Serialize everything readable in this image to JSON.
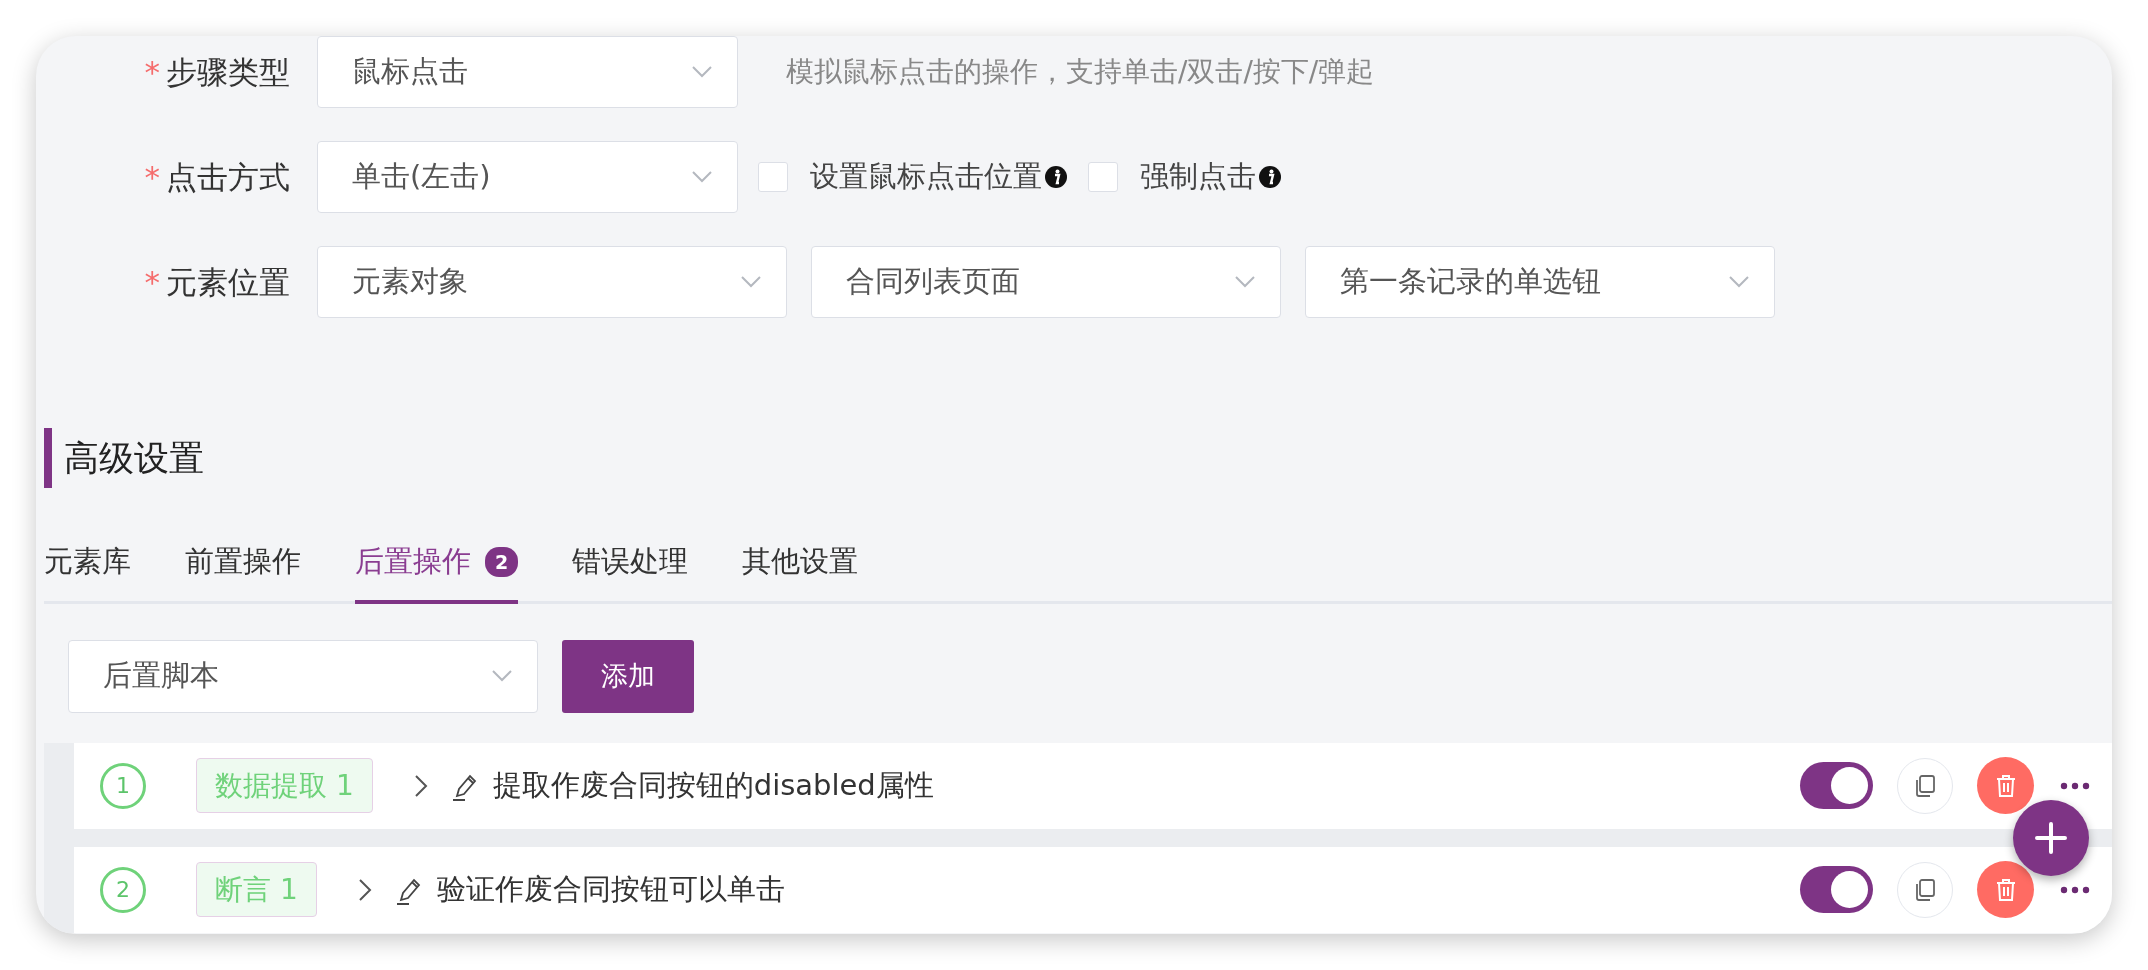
{
  "form": [
    {
      "label": "步骤类型",
      "required_mark": "*",
      "controls": [
        {
          "kind": "select",
          "value": "鼠标点击"
        },
        {
          "kind": "hint",
          "text": "模拟鼠标点击的操作，支持单击/双击/按下/弹起"
        }
      ]
    },
    {
      "label": "点击方式",
      "required_mark": "*",
      "controls": [
        {
          "kind": "select",
          "value": "单击(左击)"
        },
        {
          "kind": "checkbox",
          "label": "设置鼠标点击位置",
          "checked": false
        },
        {
          "kind": "checkbox",
          "label": "强制点击",
          "checked": false
        }
      ]
    },
    {
      "label": "元素位置",
      "required_mark": "*",
      "controls": [
        {
          "kind": "select",
          "value": "元素对象"
        },
        {
          "kind": "select",
          "value": "合同列表页面"
        },
        {
          "kind": "select",
          "value": "第一条记录的单选钮"
        }
      ]
    }
  ],
  "section_title": "高级设置",
  "tabs": [
    {
      "label": "元素库",
      "selected": false
    },
    {
      "label": "前置操作",
      "selected": false
    },
    {
      "label": "后置操作",
      "selected": true,
      "badge": "2"
    },
    {
      "label": "错误处理",
      "selected": false
    },
    {
      "label": "其他设置",
      "selected": false
    }
  ],
  "toolbar": {
    "select": "后置脚本",
    "button": "添加"
  },
  "steps": [
    {
      "number": "1",
      "tag": "数据提取 1",
      "title": "提取作废合同按钮的disabled属性",
      "enabled": true
    },
    {
      "number": "2",
      "tag": "断言 1",
      "title": "验证作废合同按钮可以单击",
      "enabled": true
    }
  ]
}
